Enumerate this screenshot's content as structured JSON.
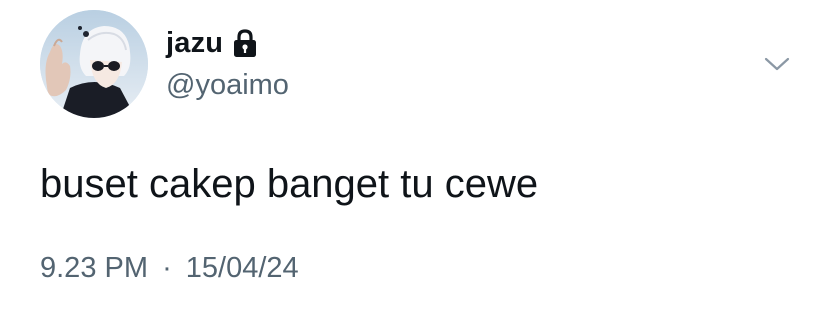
{
  "user": {
    "display_name": "jazu",
    "handle": "@yoaimo",
    "protected_icon": "lock-icon",
    "avatar_icon": "avatar-image"
  },
  "tweet": {
    "text": "buset cakep banget tu cewe",
    "time": "9.23 PM",
    "separator": "·",
    "date": "15/04/24"
  },
  "menu": {
    "icon": "chevron-down-icon"
  },
  "colors": {
    "text_primary": "#0f1419",
    "text_secondary": "#536471",
    "chevron": "#8b98a5"
  }
}
